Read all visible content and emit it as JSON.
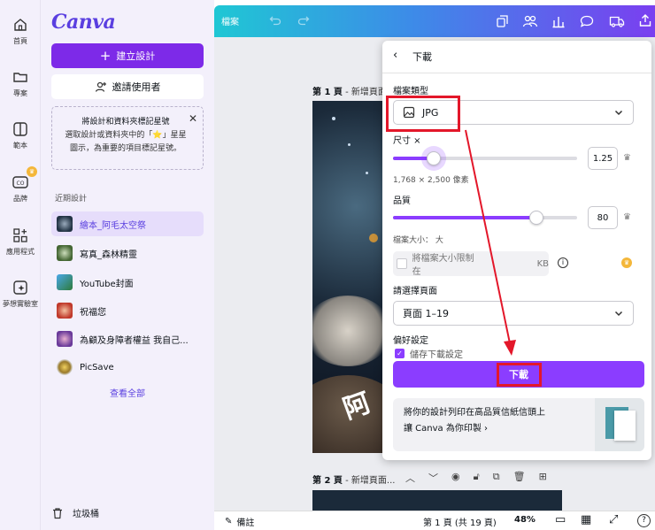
{
  "rail": [
    {
      "label": "首頁",
      "icon": "home-icon"
    },
    {
      "label": "專案",
      "icon": "folder-icon"
    },
    {
      "label": "範本",
      "icon": "template-icon"
    },
    {
      "label": "品牌",
      "icon": "brand-icon"
    },
    {
      "label": "應用程式",
      "icon": "apps-icon"
    },
    {
      "label": "夢想實驗室",
      "icon": "dream-lab-icon"
    }
  ],
  "panel": {
    "logo": "Canva",
    "create_label": "建立設計",
    "invite_label": "邀請使用者",
    "star_tip": "將設計和資料夾標記星號",
    "star_desc": "選取設計或資料夾中的「⭐」星星圖示，為重要的項目標記星號。",
    "recent_label": "近期設計",
    "recent": [
      {
        "label": "繪本_阿毛太空祭",
        "active": true
      },
      {
        "label": "寫真_森林精靈",
        "active": false
      },
      {
        "label": "YouTube封面",
        "active": false
      },
      {
        "label": "祝福您",
        "active": false
      },
      {
        "label": "為顧及身障者權益 我自己...",
        "active": false
      },
      {
        "label": "PicSave",
        "active": false
      }
    ],
    "view_all": "查看全部",
    "trash": "垃圾桶"
  },
  "topbar": {
    "file": "檔案"
  },
  "canvas": {
    "page1": "第 1 頁",
    "page1_title": " - 新增頁面...",
    "page2": "第 2 頁",
    "page2_title": " - 新增頁面..."
  },
  "bottombar": {
    "notes": "備註",
    "page_info": "第 1 頁 (共 19 頁)",
    "zoom": "48%",
    "help": "?"
  },
  "download": {
    "title": "下載",
    "file_type_label": "檔案類型",
    "file_type": "JPG",
    "size_label": "尺寸 ×",
    "size_value": "1.25",
    "size_fraction": 0.22,
    "size_pixels": "1,768 × 2,500 像素",
    "quality_label": "品質",
    "quality_value": "80",
    "quality_fraction": 0.78,
    "file_size": "檔案大小： 大",
    "limit_label": "將檔案大小限制在",
    "limit_unit": "KB",
    "pages_label": "請選擇頁面",
    "pages_value": "頁面 1–19",
    "pref_label": "偏好設定",
    "pref_item": "儲存下載設定",
    "button": "下載",
    "print_line1": "將你的設計列印在高品質信紙信頭上",
    "print_line2": "讓 Canva 為你印製"
  },
  "colors": {
    "accent": "#8b3dff",
    "highlight": "#e3172a"
  }
}
